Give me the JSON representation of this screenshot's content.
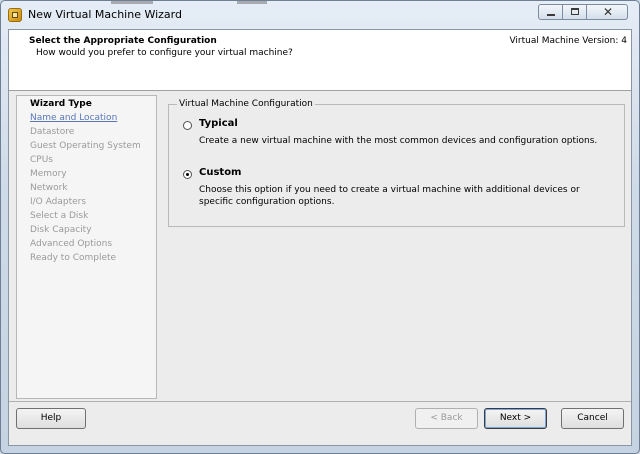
{
  "window": {
    "title": "New Virtual Machine Wizard",
    "icon": "vmware-vm-icon",
    "controls": [
      "minimize-icon",
      "maximize-icon",
      "close-icon"
    ]
  },
  "header": {
    "title": "Select the Appropriate Configuration",
    "subtitle": "How would you prefer to configure your virtual machine?",
    "version_label": "Virtual Machine Version: 4"
  },
  "nav": {
    "current": "Wizard Type",
    "next": "Name and Location",
    "items": [
      "Datastore",
      "Guest Operating System",
      "CPUs",
      "Memory",
      "Network",
      "I/O Adapters",
      "Select a Disk",
      "Disk Capacity",
      "Advanced Options",
      "Ready to Complete"
    ]
  },
  "config": {
    "legend": "Virtual Machine Configuration",
    "selected": "Custom",
    "typical": {
      "label": "Typical",
      "description": "Create a new virtual machine with the most common devices and configuration options."
    },
    "custom": {
      "label": "Custom",
      "description": "Choose this option if you need to create a virtual machine with additional devices or specific configuration options."
    }
  },
  "buttons": {
    "help": "Help",
    "back": "< Back",
    "next": "Next >",
    "cancel": "Cancel"
  },
  "colors": {
    "link": "#5a78b8",
    "disabled_text": "#9a9a9a"
  }
}
